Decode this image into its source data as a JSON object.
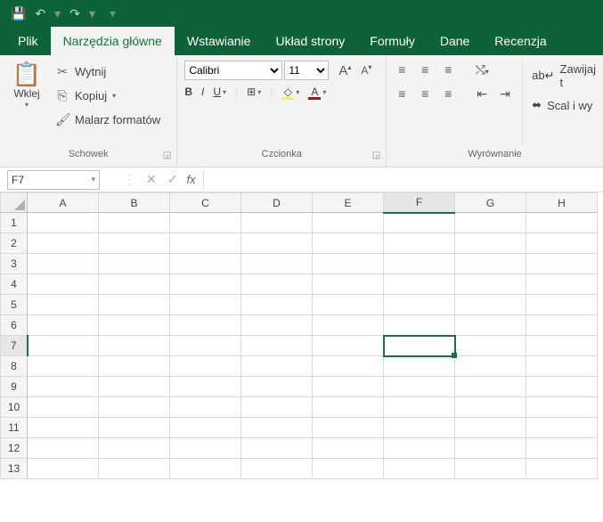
{
  "qat": {
    "save": "💾",
    "undo": "↶",
    "redo": "↷",
    "custom": "▾"
  },
  "tabs": {
    "plik": "Plik",
    "home": "Narzędzia główne",
    "insert": "Wstawianie",
    "layout": "Układ strony",
    "formulas": "Formuły",
    "data": "Dane",
    "review": "Recenzja"
  },
  "ribbon": {
    "clipboard": {
      "label": "Schowek",
      "paste": "Wklej",
      "cut": "Wytnij",
      "copy": "Kopiuj",
      "painter": "Malarz formatów"
    },
    "font": {
      "label": "Czcionka",
      "name": "Calibri",
      "size": "11",
      "bold": "B",
      "italic": "I",
      "underline": "U",
      "grow": "A",
      "shrink": "A"
    },
    "align": {
      "label": "Wyrównanie",
      "wrap": "Zawijaj t",
      "merge": "Scal i wy"
    }
  },
  "namebar": {
    "cell": "F7",
    "fx": "fx",
    "formula": ""
  },
  "grid": {
    "cols": [
      "A",
      "B",
      "C",
      "D",
      "E",
      "F",
      "G",
      "H"
    ],
    "rows": [
      "1",
      "2",
      "3",
      "4",
      "5",
      "6",
      "7",
      "8",
      "9",
      "10",
      "11",
      "12",
      "13"
    ],
    "selected_col": "F",
    "selected_row": "7"
  }
}
